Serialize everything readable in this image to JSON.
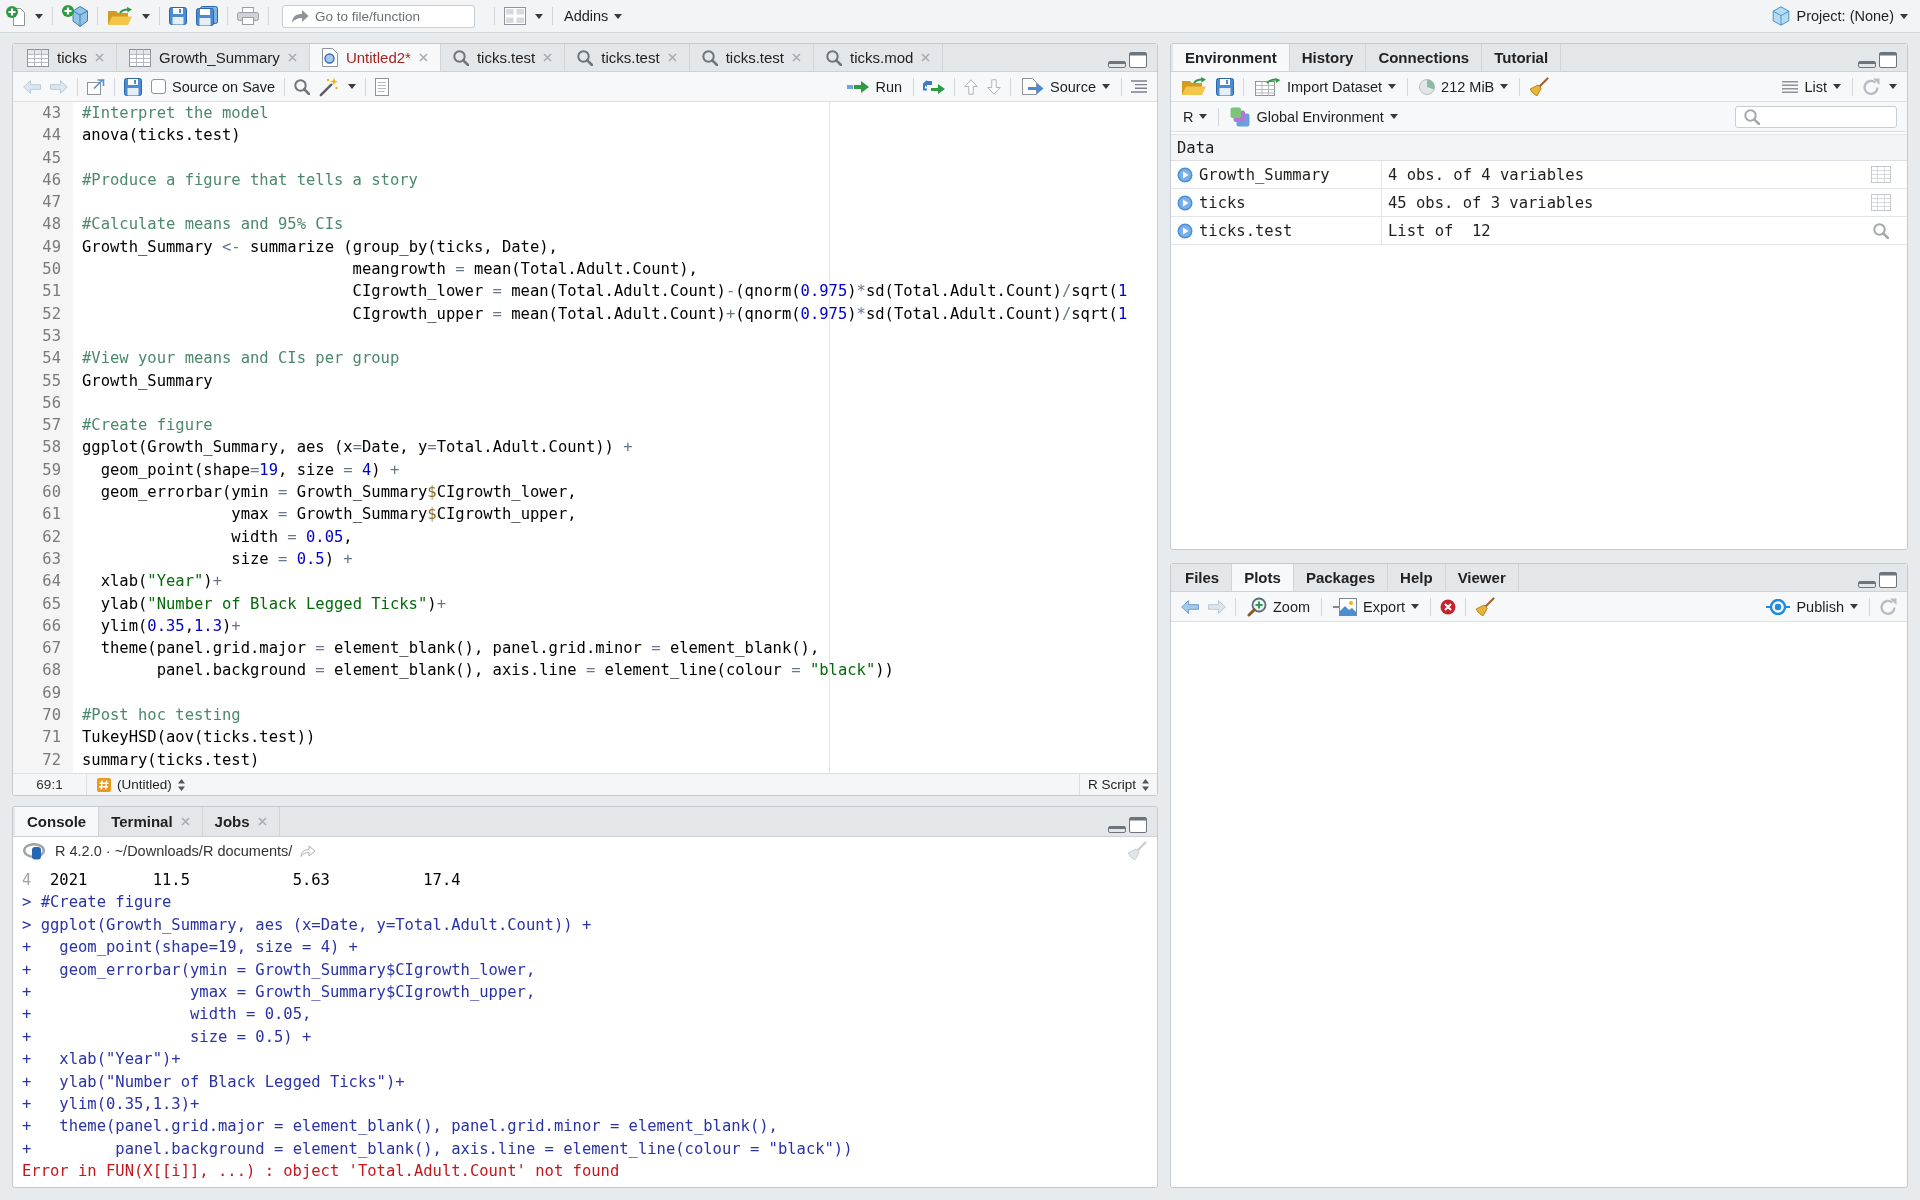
{
  "toolbar": {
    "goto_placeholder": "Go to file/function",
    "addins": "Addins",
    "project": "Project: (None)"
  },
  "editor": {
    "tabs": [
      {
        "label": "ticks",
        "kind": "data",
        "selected": false,
        "modified": false
      },
      {
        "label": "Growth_Summary",
        "kind": "data",
        "selected": false,
        "modified": false
      },
      {
        "label": "Untitled2*",
        "kind": "script",
        "selected": true,
        "modified": true
      },
      {
        "label": "ticks.test",
        "kind": "object",
        "selected": false,
        "modified": false
      },
      {
        "label": "ticks.test",
        "kind": "object",
        "selected": false,
        "modified": false
      },
      {
        "label": "ticks.test",
        "kind": "object",
        "selected": false,
        "modified": false
      },
      {
        "label": "ticks.mod",
        "kind": "object",
        "selected": false,
        "modified": false
      }
    ],
    "source_on_save": {
      "label": "Source on Save",
      "checked": false
    },
    "run": "Run",
    "source": "Source",
    "lines": [
      {
        "number": "43",
        "text": "#Interpret the model"
      },
      {
        "number": "44",
        "text": "anova(ticks.test)"
      },
      {
        "number": "45"
      },
      {
        "number": "46",
        "text": "#Produce a figure that tells a story"
      },
      {
        "number": "47"
      },
      {
        "number": "48",
        "text": "#Calculate means and 95% CIs"
      },
      {
        "number": "49",
        "text": "Growth_Summary <- summarize (group_by(ticks, Date),"
      },
      {
        "number": "50",
        "text": "                             meangrowth = mean(Total.Adult.Count),"
      },
      {
        "number": "51",
        "text": "                             CIgrowth_lower = mean(Total.Adult.Count)-(qnorm(0.975)*sd(Total.Adult.Count)/sqrt(1"
      },
      {
        "number": "52",
        "text": "                             CIgrowth_upper = mean(Total.Adult.Count)+(qnorm(0.975)*sd(Total.Adult.Count)/sqrt(1"
      },
      {
        "number": "53"
      },
      {
        "number": "54",
        "text": "#View your means and CIs per group"
      },
      {
        "number": "55",
        "text": "Growth_Summary"
      },
      {
        "number": "56"
      },
      {
        "number": "57",
        "text": "#Create figure"
      },
      {
        "number": "58",
        "text": "ggplot(Growth_Summary, aes (x=Date, y=Total.Adult.Count)) +"
      },
      {
        "number": "59",
        "text": "  geom_point(shape=19, size = 4) +"
      },
      {
        "number": "60",
        "text": "  geom_errorbar(ymin = Growth_Summary$CIgrowth_lower,"
      },
      {
        "number": "61",
        "text": "                ymax = Growth_Summary$CIgrowth_upper,"
      },
      {
        "number": "62",
        "text": "                width = 0.05,"
      },
      {
        "number": "63",
        "text": "                size = 0.5) +"
      },
      {
        "number": "64",
        "text": "  xlab(\"Year\")+"
      },
      {
        "number": "65",
        "text": "  ylab(\"Number of Black Legged Ticks\")+"
      },
      {
        "number": "66",
        "text": "  ylim(0.35,1.3)+"
      },
      {
        "number": "67",
        "text": "  theme(panel.grid.major = element_blank(), panel.grid.minor = element_blank(),"
      },
      {
        "number": "68",
        "text": "        panel.background = element_blank(), axis.line = element_line(colour = \"black\"))"
      },
      {
        "number": "69"
      },
      {
        "number": "70",
        "text": "#Post hoc testing"
      },
      {
        "number": "71",
        "text": "TukeyHSD(aov(ticks.test))"
      },
      {
        "number": "72",
        "text": "summary(ticks.test)"
      }
    ],
    "status": {
      "position": "69:1",
      "scope": "(Untitled)",
      "file_type": "R Script"
    }
  },
  "console": {
    "tabs": [
      {
        "label": "Console",
        "selected": true,
        "closable": false
      },
      {
        "label": "Terminal",
        "selected": false,
        "closable": true
      },
      {
        "label": "Jobs",
        "selected": false,
        "closable": true
      }
    ],
    "session": "R 4.2.0 · ~/Downloads/R documents/",
    "lines": [
      {
        "kind": "row",
        "index": "4",
        "text": "2021       11.5           5.63          17.4"
      },
      {
        "kind": "input",
        "prompt": ">",
        "text": "#Create figure"
      },
      {
        "kind": "input",
        "prompt": ">",
        "text": "ggplot(Growth_Summary, aes (x=Date, y=Total.Adult.Count)) +"
      },
      {
        "kind": "input",
        "prompt": "+",
        "text": "  geom_point(shape=19, size = 4) +"
      },
      {
        "kind": "input",
        "prompt": "+",
        "text": "  geom_errorbar(ymin = Growth_Summary$CIgrowth_lower,"
      },
      {
        "kind": "input",
        "prompt": "+",
        "text": "                ymax = Growth_Summary$CIgrowth_upper,"
      },
      {
        "kind": "input",
        "prompt": "+",
        "text": "                width = 0.05,"
      },
      {
        "kind": "input",
        "prompt": "+",
        "text": "                size = 0.5) +"
      },
      {
        "kind": "input",
        "prompt": "+",
        "text": "  xlab(\"Year\")+"
      },
      {
        "kind": "input",
        "prompt": "+",
        "text": "  ylab(\"Number of Black Legged Ticks\")+"
      },
      {
        "kind": "input",
        "prompt": "+",
        "text": "  ylim(0.35,1.3)+"
      },
      {
        "kind": "input",
        "prompt": "+",
        "text": "  theme(panel.grid.major = element_blank(), panel.grid.minor = element_blank(),"
      },
      {
        "kind": "input",
        "prompt": "+",
        "text": "        panel.background = element_blank(), axis.line = element_line(colour = \"black\"))"
      },
      {
        "kind": "error",
        "text": "Error in FUN(X[[i]], ...) : object 'Total.Adult.Count' not found"
      }
    ]
  },
  "environment": {
    "tabs": [
      {
        "label": "Environment",
        "selected": true
      },
      {
        "label": "History",
        "selected": false
      },
      {
        "label": "Connections",
        "selected": false
      },
      {
        "label": "Tutorial",
        "selected": false
      }
    ],
    "import": "Import Dataset",
    "memory": "212 MiB",
    "view": "List",
    "language": "R",
    "scope": "Global Environment",
    "section": "Data",
    "rows": [
      {
        "name": "Growth_Summary",
        "value": "4 obs. of 4 variables",
        "kind": "data"
      },
      {
        "name": "ticks",
        "value": "45 obs. of 3 variables",
        "kind": "data"
      },
      {
        "name": "ticks.test",
        "value": "List of  12",
        "kind": "list"
      }
    ]
  },
  "files": {
    "tabs": [
      {
        "label": "Files",
        "selected": false
      },
      {
        "label": "Plots",
        "selected": true
      },
      {
        "label": "Packages",
        "selected": false
      },
      {
        "label": "Help",
        "selected": false
      },
      {
        "label": "Viewer",
        "selected": false
      }
    ],
    "zoom": "Zoom",
    "export": "Export",
    "publish": "Publish"
  }
}
